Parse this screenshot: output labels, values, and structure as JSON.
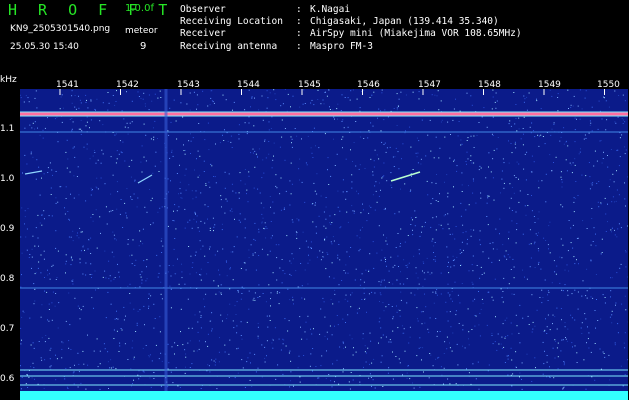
{
  "header": {
    "app_title": "H R O F F T",
    "version": "1.0.0f",
    "filename": "KN9_2505301540.png",
    "timestamp": "25.05.30 15:40",
    "meteor_label": "meteor",
    "meteor_count": "9"
  },
  "info": [
    {
      "label": "Observer",
      "sep": ":",
      "value": "K.Nagai"
    },
    {
      "label": "Receiving Location",
      "sep": ":",
      "value": "Chigasaki, Japan (139.414 35.340)"
    },
    {
      "label": "Receiver",
      "sep": ":",
      "value": "AirSpy mini (Miakejima VOR 108.65MHz)"
    },
    {
      "label": "Receiving antenna",
      "sep": ":",
      "value": "Maspro FM-3"
    }
  ],
  "axis": {
    "y_unit": "kHz",
    "y_ticks": [
      "1.1",
      "1.0",
      "0.9",
      "0.8",
      "0.7",
      "0.6"
    ],
    "x_ticks": [
      "1541",
      "1542",
      "1543",
      "1544",
      "1545",
      "1546",
      "1547",
      "1548",
      "1549",
      "1550"
    ]
  },
  "colors": {
    "background": "#0b1b8a",
    "title_green": "#26e626",
    "carrier": "#ff6ea0",
    "noise_band": "#33ffff"
  }
}
